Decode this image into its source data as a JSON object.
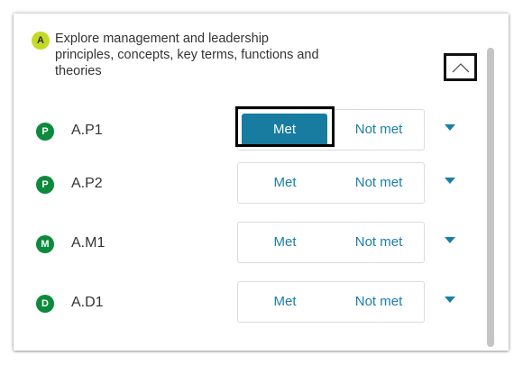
{
  "header": {
    "badge": "A",
    "text": "Explore management and leadership principles, concepts, key terms, functions and theories",
    "collapse_icon": "chevron-up-icon"
  },
  "rows": [
    {
      "badge": "P",
      "code": "A.P1",
      "met_label": "Met",
      "not_met_label": "Not met",
      "selected": "Met"
    },
    {
      "badge": "P",
      "code": "A.P2",
      "met_label": "Met",
      "not_met_label": "Not met",
      "selected": ""
    },
    {
      "badge": "M",
      "code": "A.M1",
      "met_label": "Met",
      "not_met_label": "Not met",
      "selected": ""
    },
    {
      "badge": "D",
      "code": "A.D1",
      "met_label": "Met",
      "not_met_label": "Not met",
      "selected": ""
    }
  ],
  "colors": {
    "accent": "#177c9f",
    "link": "#1a7fa6",
    "badge_green": "#0d8a3d",
    "badge_lime": "#c5da27"
  }
}
